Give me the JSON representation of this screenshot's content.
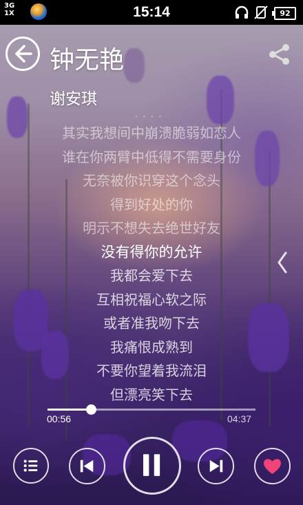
{
  "status_bar": {
    "network_type": "3G",
    "network_alt": "1X",
    "time": "15:14",
    "battery": "92",
    "icons": [
      "signal-icon",
      "globe-icon",
      "headphones-icon",
      "mute-icon",
      "battery-icon"
    ]
  },
  "header": {
    "back_icon": "back-arrow-icon",
    "song_title": "钟无艳",
    "share_icon": "share-icon"
  },
  "artist": "谢安琪",
  "lyrics_marker": "- - - -",
  "lyrics": [
    "其实我想间中崩溃脆弱如恋人",
    "谁在你两臂中低得不需要身份",
    "无奈被你识穿这个念头",
    "得到好处的你",
    "明示不想失去绝世好友",
    "没有得你的允许",
    "我都会爱下去",
    "互相祝福心软之际",
    "或者准我吻下去",
    "我痛恨成熟到",
    "不要你望着我流泪",
    "但漂亮笑下去"
  ],
  "active_lyric_index": 5,
  "playback": {
    "current_time": "00:56",
    "total_time": "04:37",
    "progress": 0.21
  },
  "controls": {
    "playlist_icon": "playlist-icon",
    "prev_icon": "previous-icon",
    "pause_icon": "pause-icon",
    "next_icon": "next-icon",
    "favorite_icon": "heart-icon"
  },
  "colors": {
    "heart": "#f0437a",
    "accent": "#ffffff"
  }
}
